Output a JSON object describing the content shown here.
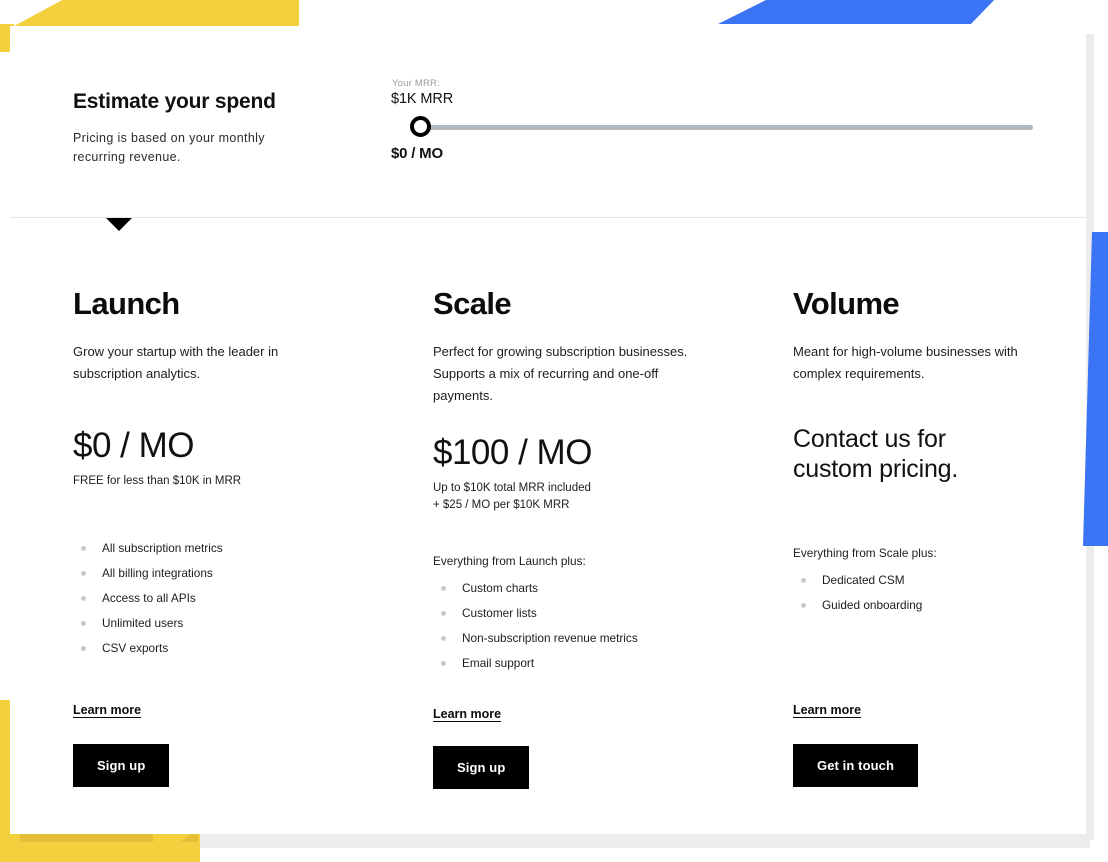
{
  "theme": {
    "yellow": "#f2d03e",
    "blue": "#3b74f5",
    "black": "#000000",
    "track_gray": "#b2babf",
    "bullet_gray": "#c9c9c9"
  },
  "estimate": {
    "title": "Estimate your spend",
    "subtitle": "Pricing is based on your monthly recurring revenue.",
    "mrr_label": "Your MRR:",
    "mrr_value": "$1K MRR",
    "price_value": "$0 / MO",
    "slider": {
      "min": 0,
      "max": 100,
      "value": 0,
      "name": "mrr-slider"
    }
  },
  "plans": [
    {
      "name": "Launch",
      "description": "Grow your startup with the leader in subscription analytics.",
      "price": "$0 / MO",
      "price_note": "FREE for less than $10K in MRR",
      "feature_intro": "",
      "features": [
        "All subscription metrics",
        "All billing integrations",
        "Access to all APIs",
        "Unlimited users",
        "CSV exports"
      ],
      "learn_more": "Learn more",
      "cta": "Sign up"
    },
    {
      "name": "Scale",
      "description": "Perfect for growing subscription businesses. Supports a mix of recurring and one-off payments.",
      "price": "$100 / MO",
      "price_note": "Up to $10K total MRR included\n+ $25 / MO per $10K MRR",
      "feature_intro": "Everything from Launch plus:",
      "features": [
        "Custom charts",
        "Customer lists",
        "Non-subscription revenue metrics",
        "Email support"
      ],
      "learn_more": "Learn more",
      "cta": "Sign up"
    },
    {
      "name": "Volume",
      "description": "Meant for high-volume businesses with complex requirements.",
      "price": "Contact us for custom pricing.",
      "price_note": "",
      "feature_intro": "Everything from Scale plus:",
      "features": [
        "Dedicated CSM",
        "Guided onboarding"
      ],
      "learn_more": "Learn more",
      "cta": "Get in touch"
    }
  ]
}
